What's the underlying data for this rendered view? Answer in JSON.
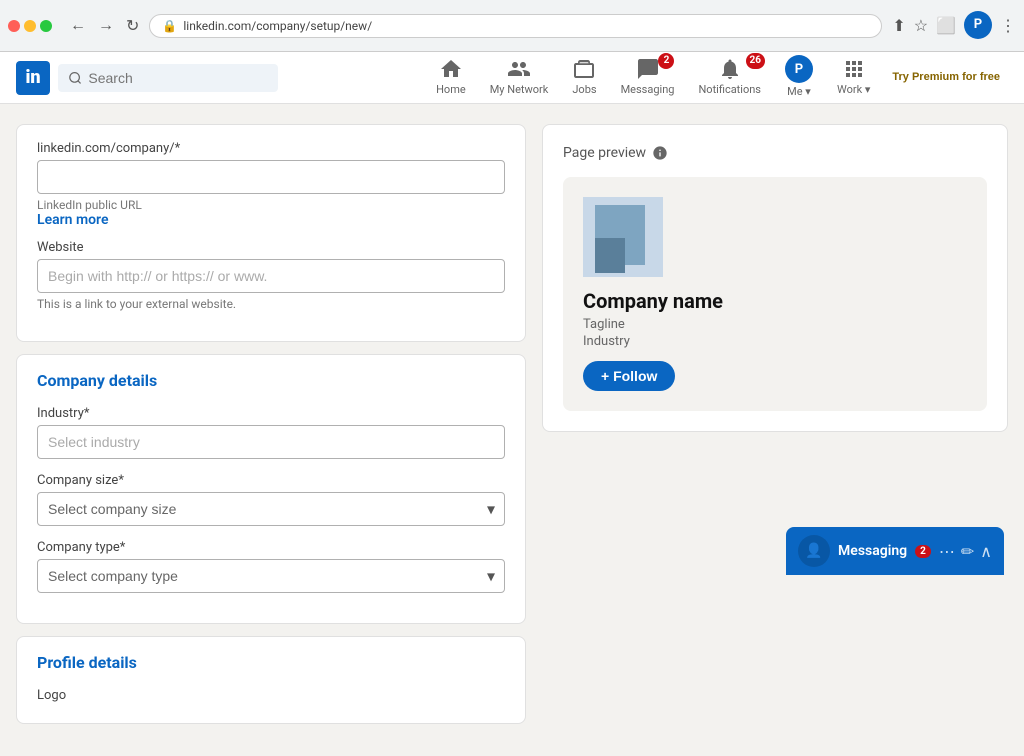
{
  "browser": {
    "url": "linkedin.com/company/setup/new/"
  },
  "nav": {
    "logo": "in",
    "search_placeholder": "Search",
    "items": [
      {
        "id": "home",
        "label": "Home",
        "icon": "home"
      },
      {
        "id": "my-network",
        "label": "My Network",
        "icon": "people"
      },
      {
        "id": "jobs",
        "label": "Jobs",
        "icon": "briefcase"
      },
      {
        "id": "messaging",
        "label": "Messaging",
        "icon": "chat",
        "badge": 2
      },
      {
        "id": "notifications",
        "label": "Notifications",
        "icon": "bell",
        "badge": 26
      },
      {
        "id": "me",
        "label": "Me",
        "icon": "avatar",
        "has_dropdown": true
      },
      {
        "id": "work",
        "label": "Work",
        "icon": "grid",
        "has_dropdown": true
      }
    ],
    "premium_label": "Try Premium for free"
  },
  "left_panel": {
    "url_section": {
      "prefix_label": "linkedin.com/company/*",
      "public_url_label": "LinkedIn public URL",
      "learn_more": "Learn more"
    },
    "website_section": {
      "label": "Website",
      "placeholder": "Begin with http:// or https:// or www.",
      "hint": "This is a link to your external website."
    },
    "company_details": {
      "section_title": "Company details",
      "industry_label": "Industry*",
      "industry_placeholder": "Select industry",
      "company_size_label": "Company size*",
      "company_size_placeholder": "Select company size",
      "company_type_label": "Company type*",
      "company_type_placeholder": "Select company type"
    },
    "profile_details": {
      "section_title": "Profile details",
      "logo_label": "Logo"
    }
  },
  "right_panel": {
    "preview_title": "Page preview",
    "company_name": "Company name",
    "tagline": "Tagline",
    "industry": "Industry",
    "follow_button": "+ Follow"
  },
  "messaging": {
    "label": "Messaging",
    "badge": 2
  }
}
